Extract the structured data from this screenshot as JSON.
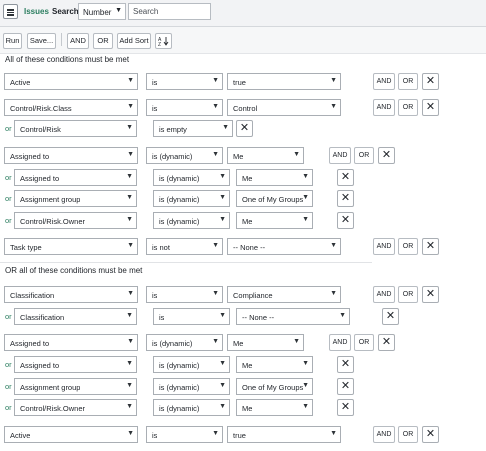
{
  "header": {
    "menu_icon": "hamburger-icon",
    "title": "Issues",
    "search_label": "Search",
    "search_field": "Number",
    "search_placeholder": "Search"
  },
  "toolbar": {
    "run": "Run",
    "save": "Save...",
    "and": "AND",
    "or": "OR",
    "add_sort": "Add Sort",
    "sort_icon": "sort-az-icon"
  },
  "groups": [
    {
      "title": "All of these conditions must be met",
      "conditions": [
        {
          "or": "",
          "field": "Active",
          "op": "is",
          "value": "true",
          "value_type": "select"
        },
        {
          "or": "",
          "field": "Control/Risk.Class",
          "op": "is",
          "value": "Control",
          "value_type": "select"
        },
        {
          "or": "or",
          "field": "Control/Risk",
          "op": "is empty",
          "value": "",
          "value_type": "none"
        },
        {
          "or": "",
          "field": "Assigned to",
          "op": "is (dynamic)",
          "value": "Me",
          "value_type": "select"
        },
        {
          "or": "or",
          "field": "Assigned to",
          "op": "is (dynamic)",
          "value": "Me",
          "value_type": "select"
        },
        {
          "or": "or",
          "field": "Assignment group",
          "op": "is (dynamic)",
          "value": "One of My Groups",
          "value_type": "select"
        },
        {
          "or": "or",
          "field": "Control/Risk.Owner",
          "op": "is (dynamic)",
          "value": "Me",
          "value_type": "select"
        },
        {
          "or": "",
          "field": "Task type",
          "op": "is not",
          "value": "-- None --",
          "value_type": "select"
        }
      ]
    },
    {
      "title": "OR all of these conditions must be met",
      "conditions": [
        {
          "or": "",
          "field": "Classification",
          "op": "is",
          "value": "Compliance",
          "value_type": "select"
        },
        {
          "or": "or",
          "field": "Classification",
          "op": "is",
          "value": "-- None --",
          "value_type": "select"
        },
        {
          "or": "",
          "field": "Assigned to",
          "op": "is (dynamic)",
          "value": "Me",
          "value_type": "select"
        },
        {
          "or": "or",
          "field": "Assigned to",
          "op": "is (dynamic)",
          "value": "Me",
          "value_type": "select"
        },
        {
          "or": "or",
          "field": "Assignment group",
          "op": "is (dynamic)",
          "value": "One of My Groups",
          "value_type": "select"
        },
        {
          "or": "or",
          "field": "Control/Risk.Owner",
          "op": "is (dynamic)",
          "value": "Me",
          "value_type": "select"
        },
        {
          "or": "",
          "field": "Active",
          "op": "is",
          "value": "true",
          "value_type": "select"
        }
      ]
    }
  ],
  "row_buttons": {
    "and": "AND",
    "or": "OR",
    "remove_icon": "close-icon"
  }
}
